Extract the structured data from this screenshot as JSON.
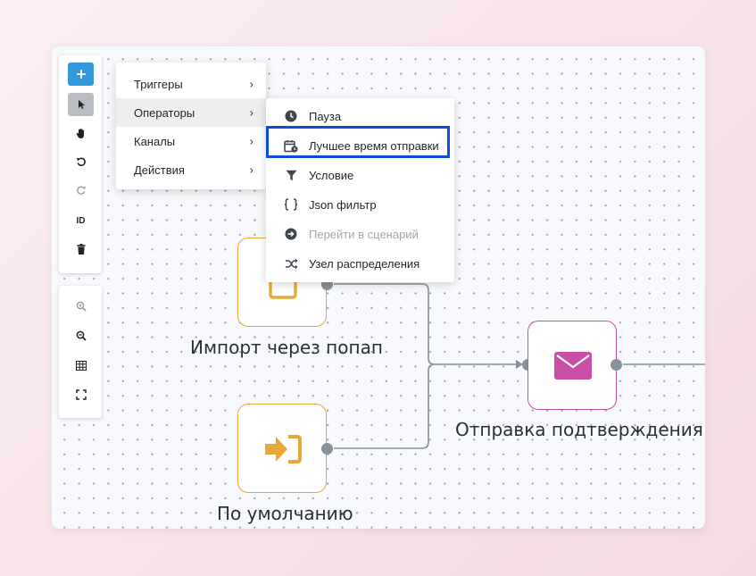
{
  "toolbar": {
    "id_label": "ID"
  },
  "menu": {
    "main_items": [
      {
        "label": "Триггеры"
      },
      {
        "label": "Операторы"
      },
      {
        "label": "Каналы"
      },
      {
        "label": "Действия"
      }
    ],
    "arrow": "›",
    "operators_submenu": [
      {
        "label": "Пауза",
        "icon": "clock-icon"
      },
      {
        "label": "Лучшее время отправки",
        "icon": "calendar-clock-icon"
      },
      {
        "label": "Условие",
        "icon": "filter-icon"
      },
      {
        "label": "Json фильтр",
        "icon": "braces-icon"
      },
      {
        "label": "Перейти в сценарий",
        "icon": "arrow-circle-right-icon",
        "disabled": true
      },
      {
        "label": "Узел распределения",
        "icon": "shuffle-icon"
      }
    ]
  },
  "nodes": [
    {
      "title": "Импорт через попап",
      "icon": "popup-icon",
      "color": "#e8a838"
    },
    {
      "title": "По умолчанию",
      "icon": "sign-in-icon",
      "color": "#e8a838"
    },
    {
      "title": "Отправка подтверждения",
      "icon": "envelope-icon",
      "color": "#c94fa6"
    }
  ],
  "colors": {
    "primary": "#3498db",
    "trigger_accent": "#e8a838",
    "channel_accent": "#c94fa6",
    "focus_outline": "#0a4fd6",
    "edge": "#8a9099"
  }
}
